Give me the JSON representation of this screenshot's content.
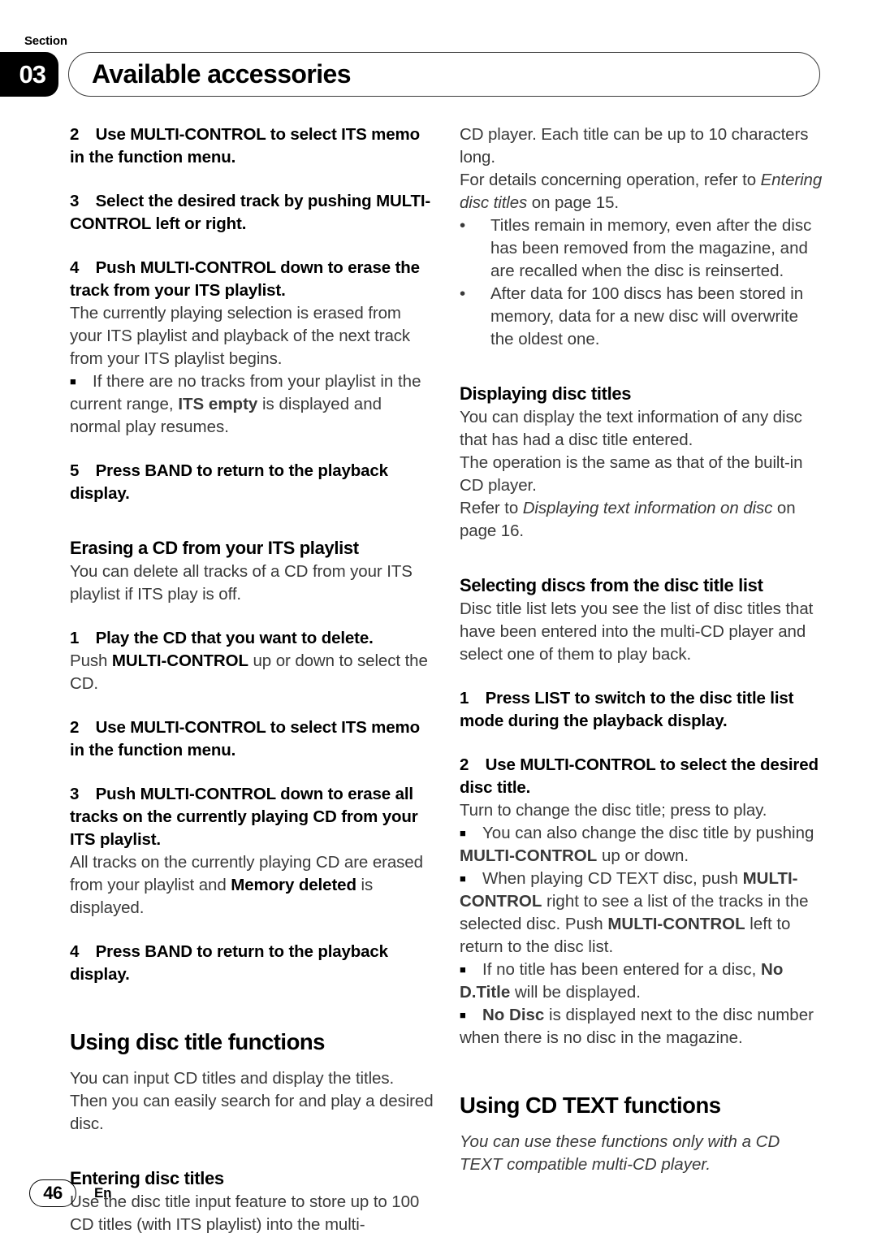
{
  "header": {
    "section_label": "Section",
    "section_number": "03",
    "title": "Available accessories"
  },
  "footer": {
    "page_number": "46",
    "language": "En"
  },
  "left_column": {
    "step2_title": "2 Use MULTI-CONTROL to select ITS memo in the function menu.",
    "step3_title": "3 Select the desired track by pushing MULTI-CONTROL left or right.",
    "step4_title": "4 Push MULTI-CONTROL down to erase the track from your ITS playlist.",
    "step4_body": "The currently playing selection is erased from your ITS playlist and playback of the next track from your ITS playlist begins.",
    "step4_note_a": "If there are no tracks from your playlist in the current range, ",
    "step4_note_b": "ITS empty",
    "step4_note_c": " is displayed and normal play resumes.",
    "step5_title": "5 Press BAND to return to the playback display.",
    "erasing_head": "Erasing a CD from your ITS playlist",
    "erasing_body": "You can delete all tracks of a CD from your ITS playlist if ITS play is off.",
    "e_step1_title": "1 Play the CD that you want to delete.",
    "e_step1_body_a": "Push ",
    "e_step1_body_b": "MULTI-CONTROL",
    "e_step1_body_c": " up or down to select the CD.",
    "e_step2_title": "2 Use MULTI-CONTROL to select ITS memo in the function menu.",
    "e_step3_title": "3 Push MULTI-CONTROL down to erase all tracks on the currently playing CD from your ITS playlist.",
    "e_step3_body_a": "All tracks on the currently playing CD are erased from your playlist and ",
    "e_step3_body_b": "Memory deleted",
    "e_step3_body_c": " is displayed.",
    "e_step4_title": "4 Press BAND to return to the playback display.",
    "disc_title_head": "Using disc title functions",
    "disc_title_body": "You can input CD titles and display the titles. Then you can easily search for and play a desired disc.",
    "entering_head": "Entering disc titles",
    "entering_body": "Use the disc title input feature to store up to 100 CD titles  (with ITS playlist) into the multi-"
  },
  "right_column": {
    "cont_body": "CD player. Each title can be up to 10 characters long.",
    "refer_a": "For details concerning operation, refer to ",
    "refer_i": "Entering disc titles",
    "refer_b": " on page 15.",
    "bullet1": "Titles remain in memory, even after the disc has been removed from the magazine, and are recalled when the disc is reinserted.",
    "bullet2": "After data for 100 discs has been stored in memory, data for a new disc will overwrite the oldest one.",
    "displaying_head": "Displaying disc titles",
    "displaying_body1": "You can display the text information of any disc that has had a disc title entered.",
    "displaying_body2": "The operation is the same as that of the built-in CD player.",
    "displaying_refer_a": "Refer to ",
    "displaying_refer_i": "Displaying text information on disc",
    "displaying_refer_b": " on page 16.",
    "selecting_head": "Selecting discs from the disc title list",
    "selecting_body": "Disc title list lets you see the list of disc titles that have been entered into the multi-CD player and select one of them to play back.",
    "s_step1_title": "1 Press LIST to switch to the disc title list mode during the playback display.",
    "s_step2_title": "2 Use MULTI-CONTROL to select the desired disc title.",
    "s_step2_body": "Turn to change the disc title; press to play.",
    "note1_a": "You can also change the disc title by pushing ",
    "note1_b": "MULTI-CONTROL",
    "note1_c": " up or down.",
    "note2_a": "When playing CD TEXT disc, push ",
    "note2_b": "MULTI-CONTROL",
    "note2_c": " right to see a list of the tracks in the selected disc. Push ",
    "note2_d": "MULTI-CONTROL",
    "note2_e": " left to return to the disc list.",
    "note3_a": "If no title has been entered for a disc, ",
    "note3_b": "No D.Title",
    "note3_c": " will be displayed.",
    "note4_a": "",
    "note4_b": "No Disc",
    "note4_c": " is displayed next to the disc number when there is no disc in the magazine.",
    "cdtext_head": "Using CD TEXT functions",
    "cdtext_body": "You can use these functions only with a CD TEXT compatible multi-CD player."
  }
}
